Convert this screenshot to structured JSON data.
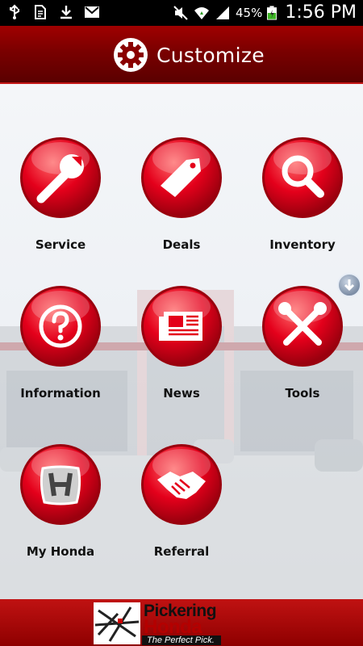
{
  "status_bar": {
    "battery_percent": "45%",
    "time": "1:56 PM",
    "icons": [
      "usb-icon",
      "document-icon",
      "download-icon",
      "gmail-icon",
      "mute-icon",
      "wifi-icon",
      "signal-icon",
      "battery-icon"
    ]
  },
  "header": {
    "title": "Customize",
    "icon": "gear-icon"
  },
  "tiles": [
    {
      "label": "Service",
      "icon": "wrench-icon"
    },
    {
      "label": "Deals",
      "icon": "tag-icon"
    },
    {
      "label": "Inventory",
      "icon": "magnifier-icon"
    },
    {
      "label": "Information",
      "icon": "question-icon"
    },
    {
      "label": "News",
      "icon": "newspaper-icon"
    },
    {
      "label": "Tools",
      "icon": "tools-icon"
    },
    {
      "label": "My Honda",
      "icon": "honda-logo-icon"
    },
    {
      "label": "Referral",
      "icon": "handshake-icon"
    }
  ],
  "footer": {
    "logo_line1": "Pickering",
    "logo_line2": "Honda",
    "logo_tagline": "The Perfect Pick."
  },
  "colors": {
    "header_red": "#8a0000",
    "button_red": "#e4001b",
    "footer_red": "#b00000"
  }
}
